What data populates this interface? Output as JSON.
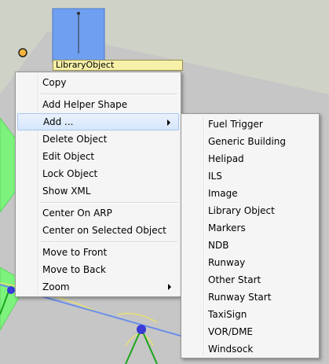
{
  "canvas": {
    "object_label": "LibraryObject",
    "colors": {
      "ground": "#c8c8c8",
      "background": "#cfd2c6",
      "library_object": "#6f9ff1",
      "apron": "#7df37d",
      "taxiway_line": "#6b8ee8",
      "node": "#3a3ad6",
      "handle": "#f5b43a"
    }
  },
  "context_menu": {
    "items": [
      {
        "label": "Copy"
      },
      {
        "label": "Add Helper Shape"
      },
      {
        "label": "Add ...",
        "has_submenu": true,
        "highlighted": true
      },
      {
        "label": "Delete Object"
      },
      {
        "label": "Edit Object"
      },
      {
        "label": "Lock Object"
      },
      {
        "label": "Show XML"
      },
      {
        "label": "Center On ARP"
      },
      {
        "label": "Center on Selected Object"
      },
      {
        "label": "Move to Front"
      },
      {
        "label": "Move to Back"
      },
      {
        "label": "Zoom",
        "has_submenu": true
      }
    ]
  },
  "add_submenu": {
    "items": [
      {
        "label": "Fuel Trigger"
      },
      {
        "label": "Generic Building"
      },
      {
        "label": "Helipad"
      },
      {
        "label": "ILS"
      },
      {
        "label": "Image"
      },
      {
        "label": "Library Object"
      },
      {
        "label": "Markers"
      },
      {
        "label": "NDB"
      },
      {
        "label": "Runway"
      },
      {
        "label": "Other Start"
      },
      {
        "label": "Runway Start"
      },
      {
        "label": "TaxiSign"
      },
      {
        "label": "VOR/DME"
      },
      {
        "label": "Windsock"
      }
    ]
  }
}
